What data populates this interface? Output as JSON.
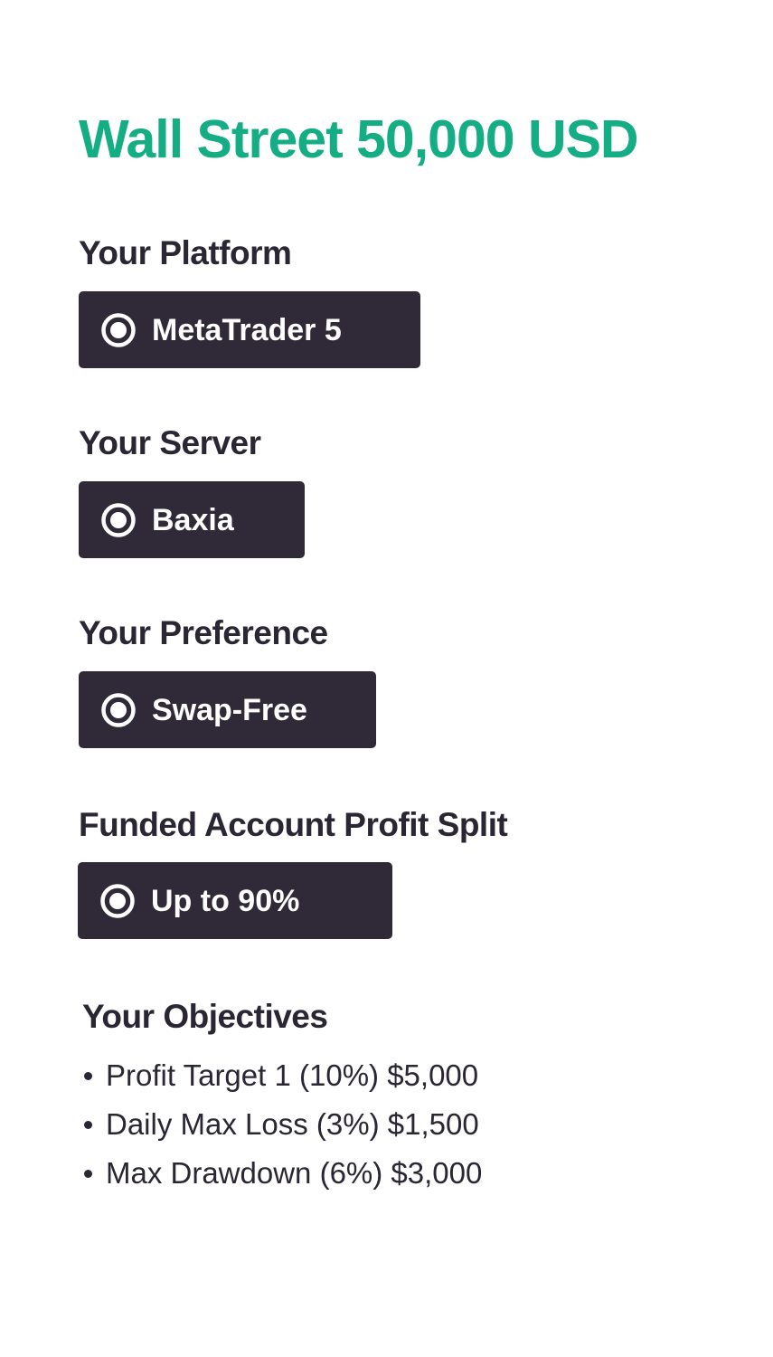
{
  "title": "Wall Street 50,000 USD",
  "colors": {
    "title": "#15ae84",
    "chip_background": "#302937",
    "chip_text": "#ffffff",
    "heading_text": "#2b2633"
  },
  "sections": [
    {
      "heading": "Your Platform",
      "option": "MetaTrader 5",
      "icon": "radio-selected-icon"
    },
    {
      "heading": "Your Server",
      "option": "Baxia",
      "icon": "radio-selected-icon"
    },
    {
      "heading": "Your Preference",
      "option": "Swap-Free",
      "icon": "radio-selected-icon"
    },
    {
      "heading": "Funded Account Profit Split",
      "option": "Up to 90%",
      "icon": "radio-selected-icon"
    }
  ],
  "objectives": {
    "heading": "Your Objectives",
    "items": [
      "Profit Target 1 (10%) $5,000",
      "Daily Max Loss (3%) $1,500",
      "Max Drawdown (6%) $3,000"
    ]
  }
}
